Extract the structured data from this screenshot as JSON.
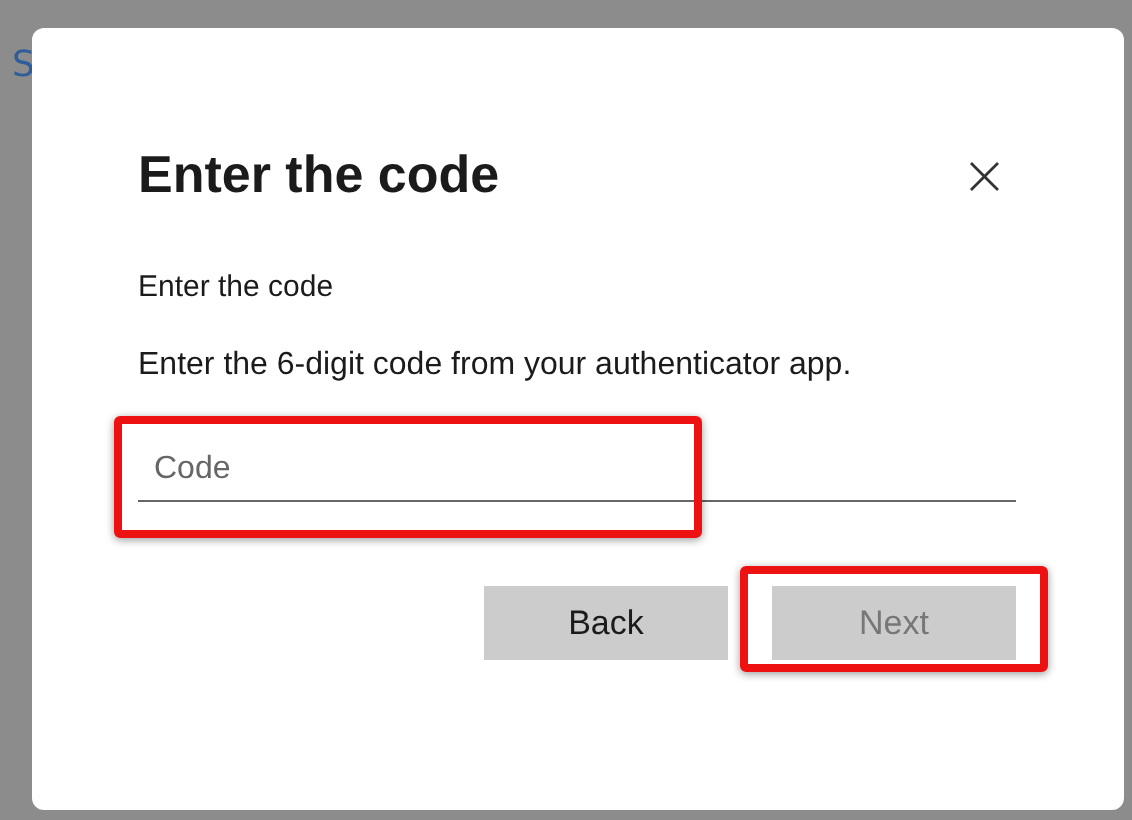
{
  "background": {
    "text": "S"
  },
  "dialog": {
    "title": "Enter the code",
    "close": "×",
    "label": "Enter the code",
    "description": "Enter the 6-digit code from your authenticator app.",
    "code_field": {
      "placeholder": "Code",
      "highlighted": true
    },
    "buttons": [
      {
        "label": "Back",
        "disabled": false,
        "highlighted": false
      },
      {
        "label": "Next",
        "disabled": true,
        "highlighted": true
      }
    ]
  }
}
